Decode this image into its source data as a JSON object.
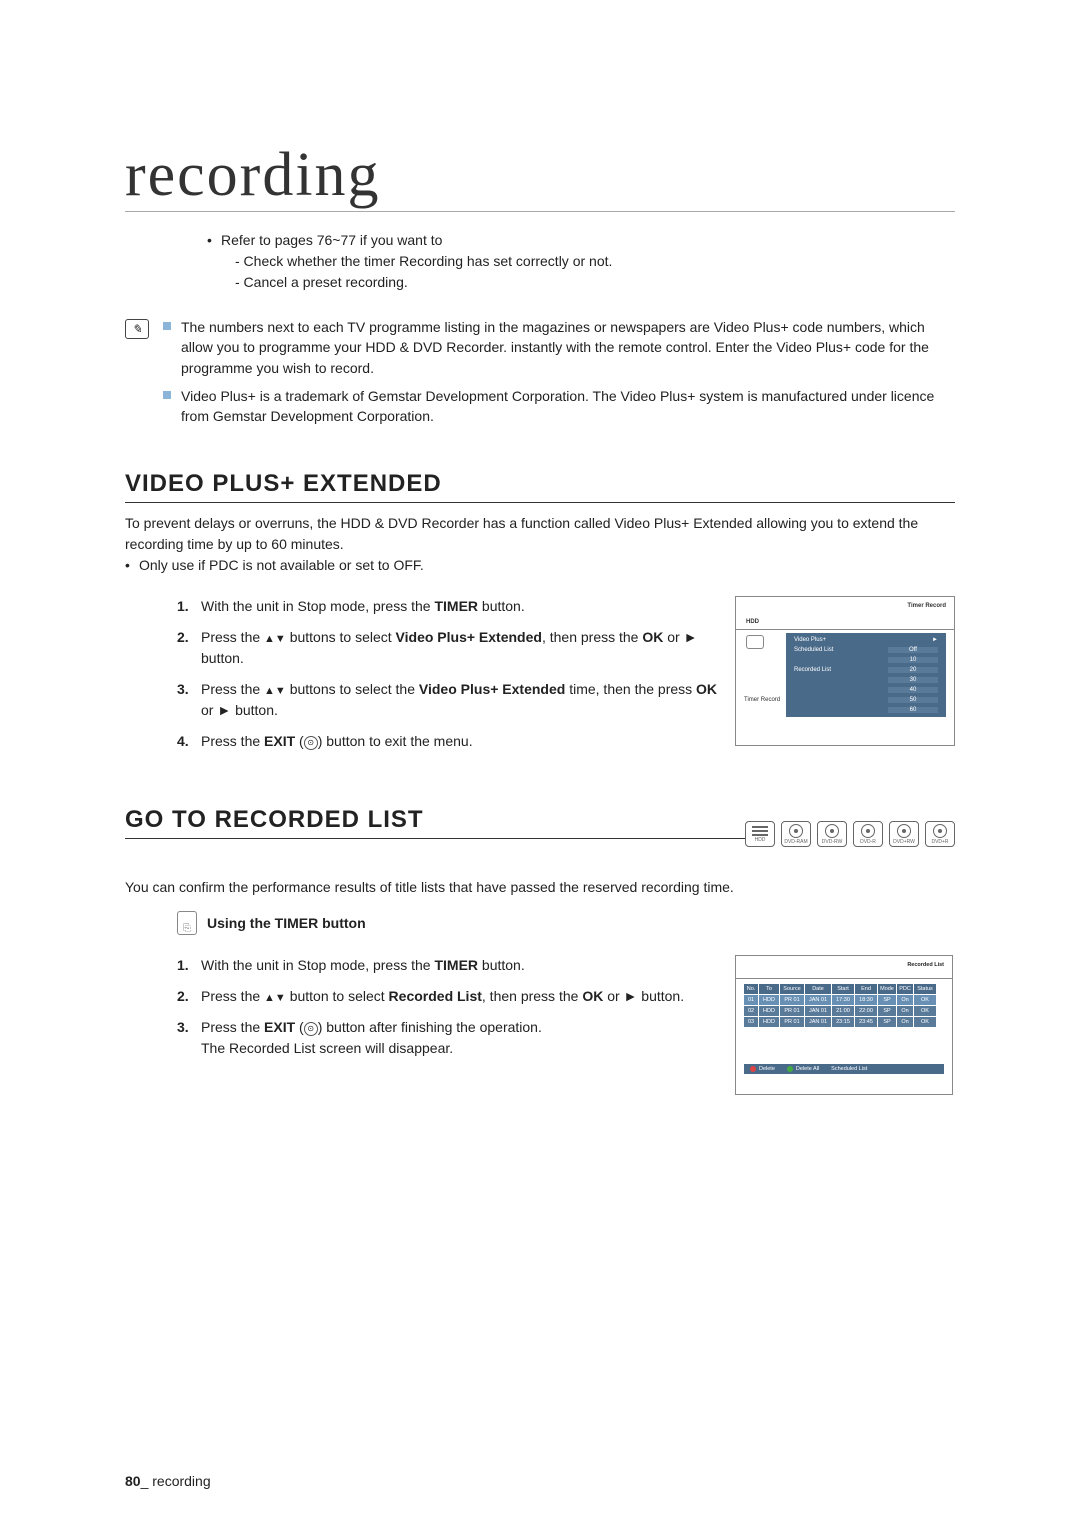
{
  "page": {
    "title": "recording",
    "refer_bullet": "Refer to pages 76~77 if you want to",
    "refer_sub1": "- Check whether the timer Recording has set correctly or not.",
    "refer_sub2": "- Cancel a preset recording."
  },
  "notes": {
    "n1": "The numbers next to each TV programme listing in the magazines or newspapers are Video Plus+ code numbers, which allow you to programme your HDD & DVD Recorder. instantly with the remote control. Enter the Video Plus+ code for the programme you wish to record.",
    "n2": "Video Plus+ is a trademark of Gemstar Development Corporation. The Video Plus+ system is manufactured under licence from Gemstar Development Corporation."
  },
  "vpe": {
    "heading": "VIDEO PLUS+ EXTENDED",
    "intro": "To prevent delays or overruns, the HDD & DVD Recorder has a function called Video Plus+ Extended allowing you to extend the recording time by up to 60 minutes.",
    "intro_bullet": "Only use if PDC is not available or set to OFF.",
    "step1_a": "With the unit in Stop mode, press the ",
    "step1_b": "TIMER",
    "step1_c": " button.",
    "step2_a": "Press the ",
    "step2_b": " buttons to select ",
    "step2_c": "Video Plus+ Extended",
    "step2_d": ", then press the ",
    "step2_e": "OK",
    "step2_f": " or ► button.",
    "step3_a": "Press the ",
    "step3_b": " buttons to select the ",
    "step3_c": "Video Plus+ Extended",
    "step3_d": " time, then the press ",
    "step3_e": "OK",
    "step3_f": " or ► button.",
    "step4_a": "Press the ",
    "step4_b": "EXIT",
    "step4_c": " (",
    "step4_d": ") button to exit the menu."
  },
  "timer_record": {
    "title": "Timer Record",
    "hdd": "HDD",
    "menu": {
      "video_plus": "Video Plus+",
      "scheduled": "Scheduled List",
      "recorded": "Recorded List"
    },
    "options": [
      "Off",
      "10",
      "20",
      "30",
      "40",
      "50",
      "60"
    ],
    "sidebar_label": "Timer Record"
  },
  "grl": {
    "heading": "GO TO RECORDED LIST",
    "intro": "You can confirm the performance results of title lists that have passed the reserved recording time.",
    "sub_heading": "Using the TIMER button",
    "step1_a": "With the unit in Stop mode, press the ",
    "step1_b": "TIMER",
    "step1_c": " button.",
    "step2_a": "Press the ",
    "step2_b": " button to select ",
    "step2_c": "Recorded List",
    "step2_d": ", then press the ",
    "step2_e": "OK",
    "step2_f": " or ► button.",
    "step3_a": "Press the ",
    "step3_b": "EXIT",
    "step3_c": " (",
    "step3_d": ") button after finishing the operation.",
    "step3_e": "The Recorded List screen will disappear."
  },
  "media": {
    "hdd": "HDD",
    "dvd_ram": "DVD-RAM",
    "dvd_rw": "DVD-RW",
    "dvd_r": "DVD-R",
    "dvd_plus_rw": "DVD+RW",
    "dvd_plus_r": "DVD+R"
  },
  "recorded_list": {
    "title": "Recorded List",
    "headers": [
      "No.",
      "To",
      "Source",
      "Date",
      "Start",
      "End",
      "Mode",
      "PDC",
      "Status"
    ],
    "rows": [
      [
        "01",
        "HDD",
        "PR 01",
        "JAN 01",
        "17:30",
        "18:30",
        "SP",
        "On",
        "OK"
      ],
      [
        "02",
        "HDD",
        "PR 01",
        "JAN 01",
        "21:00",
        "22:00",
        "SP",
        "On",
        "OK"
      ],
      [
        "03",
        "HDD",
        "PR 01",
        "JAN 01",
        "23:15",
        "23:45",
        "SP",
        "On",
        "OK"
      ]
    ],
    "actions": {
      "delete": "Delete",
      "delete_all": "Delete All",
      "scheduled": "Scheduled List"
    }
  },
  "footer": {
    "pagenum": "80",
    "label": "_ recording"
  }
}
